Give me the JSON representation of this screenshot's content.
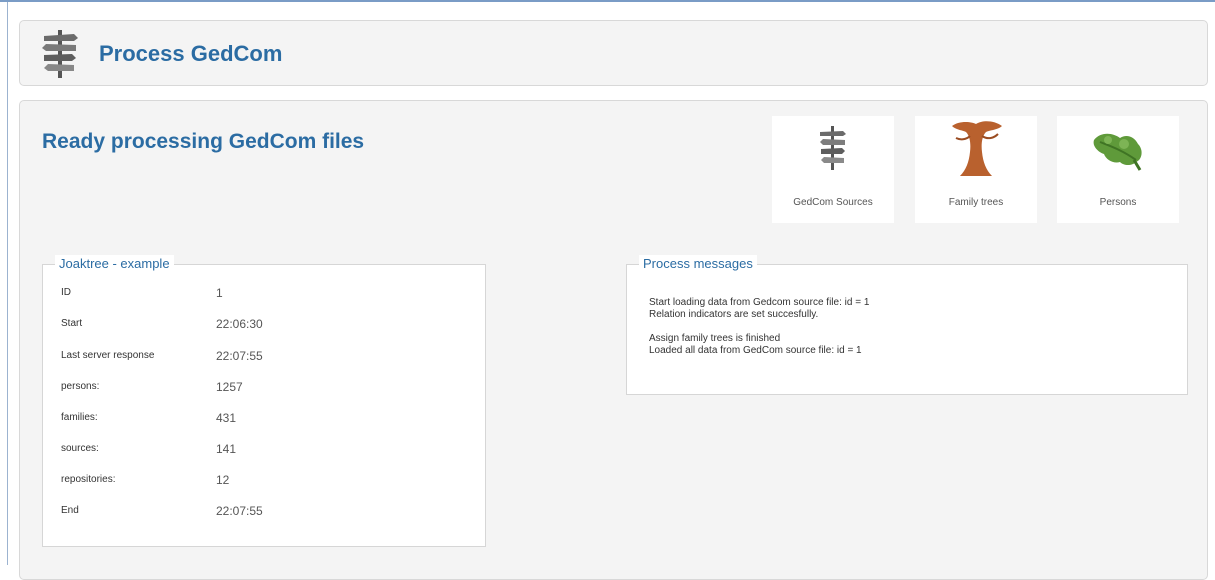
{
  "header": {
    "title": "Process GedCom"
  },
  "page": {
    "title": "Ready processing GedCom files"
  },
  "tiles": [
    {
      "label": "GedCom Sources",
      "icon": "signpost-icon"
    },
    {
      "label": "Family trees",
      "icon": "tree-icon"
    },
    {
      "label": "Persons",
      "icon": "leaf-icon"
    }
  ],
  "info": {
    "legend": "Joaktree - example",
    "rows": [
      {
        "label": "ID",
        "value": "1"
      },
      {
        "label": "Start",
        "value": "22:06:30"
      },
      {
        "label": "Last server response",
        "value": "22:07:55"
      },
      {
        "label": "persons:",
        "value": "1257"
      },
      {
        "label": "families:",
        "value": "431"
      },
      {
        "label": "sources:",
        "value": "141"
      },
      {
        "label": "repositories:",
        "value": "12"
      },
      {
        "label": "End",
        "value": "22:07:55"
      }
    ]
  },
  "messages": {
    "legend": "Process messages",
    "lines": [
      "Start loading data from Gedcom source file: id = 1",
      "Relation indicators are set succesfully.",
      "",
      "Assign family trees is finished",
      "Loaded all data from GedCom source file: id = 1"
    ]
  }
}
